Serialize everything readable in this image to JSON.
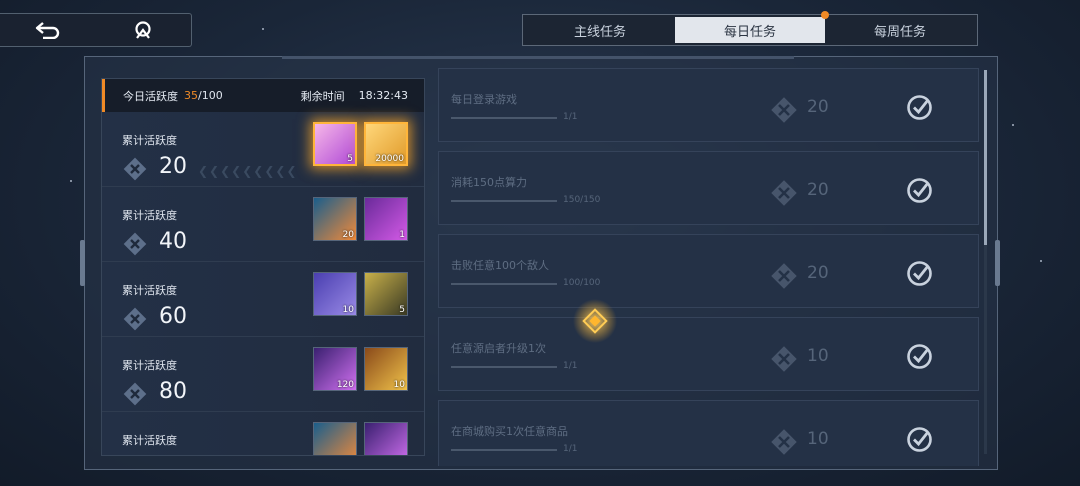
{
  "nav": {
    "back_icon": "back-arrow-icon",
    "home_icon": "hub-icon"
  },
  "tabs": [
    {
      "label": "主线任务",
      "active": false
    },
    {
      "label": "每日任务",
      "active": true,
      "badge": true
    },
    {
      "label": "每周任务",
      "active": false
    }
  ],
  "activity": {
    "label": "今日活跃度",
    "current": "35",
    "max": "/100",
    "time_label": "剩余时间",
    "time_value": "18:32:43"
  },
  "milestones": [
    {
      "label": "累计活跃度",
      "value": "20",
      "claimable": true,
      "rewards": [
        {
          "icon": "ticket-item",
          "count": "5",
          "color": "pink"
        },
        {
          "icon": "coin-card-item",
          "count": "20000",
          "color": "gold"
        }
      ]
    },
    {
      "label": "累计活跃度",
      "value": "40",
      "claimable": false,
      "rewards": [
        {
          "icon": "crystal-star-item",
          "count": "20",
          "color": "orange"
        },
        {
          "icon": "chest-item",
          "count": "1",
          "color": "purple"
        }
      ]
    },
    {
      "label": "累计活跃度",
      "value": "60",
      "claimable": false,
      "rewards": [
        {
          "icon": "crystal-shard-item",
          "count": "10",
          "color": "blue"
        },
        {
          "icon": "chip-item",
          "count": "5",
          "color": "olive"
        }
      ]
    },
    {
      "label": "累计活跃度",
      "value": "80",
      "claimable": false,
      "rewards": [
        {
          "icon": "orb-item",
          "count": "120",
          "color": "violet"
        },
        {
          "icon": "core-item",
          "count": "10",
          "color": "amber"
        }
      ]
    },
    {
      "label": "累计活跃度",
      "value": "",
      "claimable": false,
      "rewards": [
        {
          "icon": "blade-item",
          "count": "",
          "color": "orange"
        },
        {
          "icon": "rod-item",
          "count": "",
          "color": "violet"
        }
      ]
    }
  ],
  "tasks": [
    {
      "name": "每日登录游戏",
      "progress": "1/1",
      "points": "20",
      "completed": true
    },
    {
      "name": "消耗150点算力",
      "progress": "150/150",
      "points": "20",
      "completed": true
    },
    {
      "name": "击败任意100个敌人",
      "progress": "100/100",
      "points": "20",
      "completed": true
    },
    {
      "name": "任意源启者升级1次",
      "progress": "1/1",
      "points": "10",
      "completed": true
    },
    {
      "name": "在商城购买1次任意商品",
      "progress": "1/1",
      "points": "10",
      "completed": true
    }
  ],
  "colors": {
    "accent": "#f08a26",
    "active_tab_bg": "#e2e6ec",
    "glow": "#ffb53a"
  }
}
